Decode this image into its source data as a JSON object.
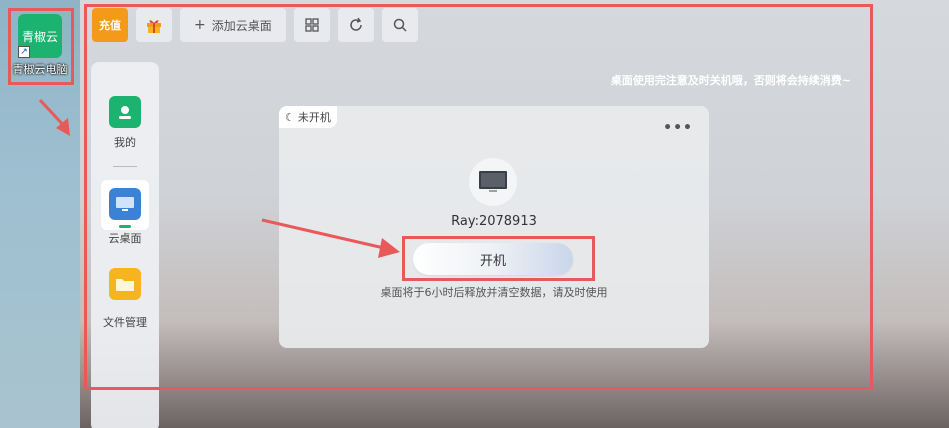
{
  "desktop": {
    "shortcut": {
      "icon_text": "青椒云",
      "label": "青椒云电脑",
      "shortcut_mark": "↗"
    }
  },
  "toolbar": {
    "recharge_label": "充值",
    "gift_icon": "gift-icon",
    "add_desktop_label": "添加云桌面",
    "add_icon": "plus-icon",
    "grid_icon": "grid-icon",
    "refresh_icon": "refresh-icon",
    "search_icon": "search-icon"
  },
  "sidebar": {
    "items": [
      {
        "label": "我的",
        "icon": "user-icon"
      },
      {
        "label": "云桌面",
        "icon": "monitor-icon"
      },
      {
        "label": "文件管理",
        "icon": "folder-icon"
      }
    ],
    "active_index": 1
  },
  "notice": "桌面使用完注意及时关机哦，否则将会持续消费~",
  "card": {
    "status": "未开机",
    "status_icon": "moon-icon",
    "more_label": "•••",
    "vm_name": "Ray:2078913",
    "boot_label": "开机",
    "release_note": "桌面将于6小时后释放并清空数据，请及时使用"
  },
  "colors": {
    "accent_green": "#1bb36f",
    "recharge_orange": "#f39a1a",
    "highlight_red": "#e85a5a",
    "folder_yellow": "#f6b51e",
    "monitor_blue": "#3b82d6"
  }
}
